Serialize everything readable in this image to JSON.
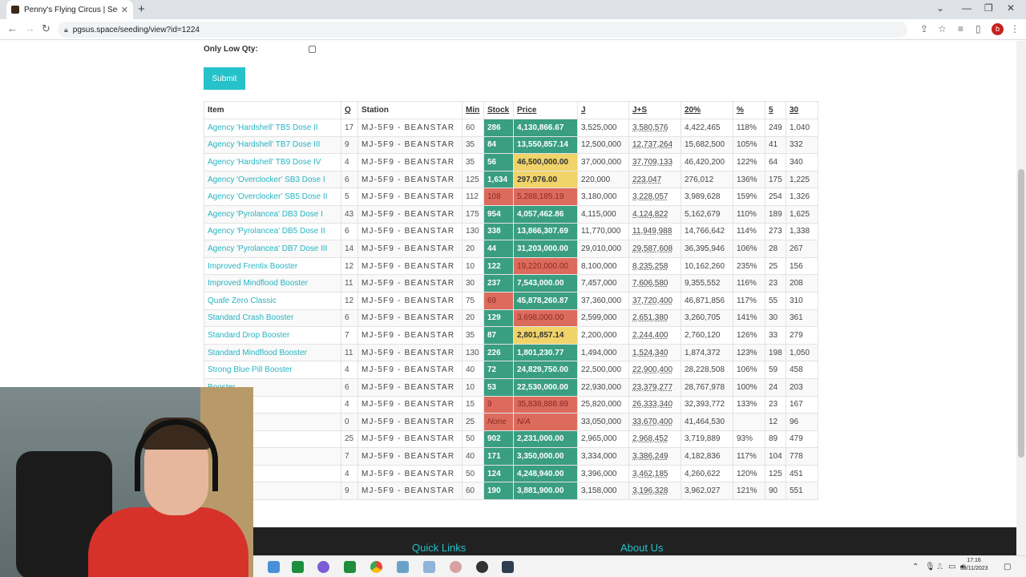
{
  "browser": {
    "tab_title": "Penny's Flying Circus | Seeding",
    "url": "pgsus.space/seeding/view?id=1224"
  },
  "form": {
    "low_qty_label": "Only Low Qty:",
    "submit_label": "Submit"
  },
  "table": {
    "headers": [
      "Item",
      "Q",
      "Station",
      "Min",
      "Stock",
      "Price",
      "J",
      "J+S",
      "20%",
      "%",
      "5",
      "30"
    ],
    "rows": [
      {
        "item": "Agency 'Hardshell' TB5 Dose II",
        "q": "17",
        "station": "MJ-5F9 - BEANSTAR",
        "min": "60",
        "stock": "286",
        "stock_color": "green",
        "price": "4,130,866.67",
        "price_color": "green",
        "j": "3,525,000",
        "js": "3,580,576",
        "p20": "4,422,465",
        "pct": "118%",
        "f5": "249",
        "t30": "1,040"
      },
      {
        "item": "Agency 'Hardshell' TB7 Dose III",
        "q": "9",
        "station": "MJ-5F9 - BEANSTAR",
        "min": "35",
        "stock": "84",
        "stock_color": "green",
        "price": "13,550,857.14",
        "price_color": "green",
        "j": "12,500,000",
        "js": "12,737,264",
        "p20": "15,682,500",
        "pct": "105%",
        "f5": "41",
        "t30": "332"
      },
      {
        "item": "Agency 'Hardshell' TB9 Dose IV",
        "q": "4",
        "station": "MJ-5F9 - BEANSTAR",
        "min": "35",
        "stock": "56",
        "stock_color": "green",
        "price": "46,500,000.00",
        "price_color": "yellow",
        "j": "37,000,000",
        "js": "37,709,133",
        "p20": "46,420,200",
        "pct": "122%",
        "f5": "64",
        "t30": "340"
      },
      {
        "item": "Agency 'Overclocker' SB3 Dose I",
        "q": "6",
        "station": "MJ-5F9 - BEANSTAR",
        "min": "125",
        "stock": "1,634",
        "stock_color": "green",
        "price": "297,976.00",
        "price_color": "yellow",
        "j": "220,000",
        "js": "223,047",
        "p20": "276,012",
        "pct": "136%",
        "f5": "175",
        "t30": "1,225"
      },
      {
        "item": "Agency 'Overclocker' SB5 Dose II",
        "q": "5",
        "station": "MJ-5F9 - BEANSTAR",
        "min": "112",
        "stock": "108",
        "stock_color": "red",
        "price": "5,288,185.19",
        "price_color": "red",
        "j": "3,180,000",
        "js": "3,228,057",
        "p20": "3,989,628",
        "pct": "159%",
        "f5": "254",
        "t30": "1,326"
      },
      {
        "item": "Agency 'Pyrolancea' DB3 Dose I",
        "q": "43",
        "station": "MJ-5F9 - BEANSTAR",
        "min": "175",
        "stock": "954",
        "stock_color": "green",
        "price": "4,057,462.86",
        "price_color": "green",
        "j": "4,115,000",
        "js": "4,124,822",
        "p20": "5,162,679",
        "pct": "110%",
        "f5": "189",
        "t30": "1,625"
      },
      {
        "item": "Agency 'Pyrolancea' DB5 Dose II",
        "q": "6",
        "station": "MJ-5F9 - BEANSTAR",
        "min": "130",
        "stock": "338",
        "stock_color": "green",
        "price": "13,866,307.69",
        "price_color": "green",
        "j": "11,770,000",
        "js": "11,949,988",
        "p20": "14,766,642",
        "pct": "114%",
        "f5": "273",
        "t30": "1,338"
      },
      {
        "item": "Agency 'Pyrolancea' DB7 Dose III",
        "q": "14",
        "station": "MJ-5F9 - BEANSTAR",
        "min": "20",
        "stock": "44",
        "stock_color": "green",
        "price": "31,203,000.00",
        "price_color": "green",
        "j": "29,010,000",
        "js": "29,587,608",
        "p20": "36,395,946",
        "pct": "106%",
        "f5": "28",
        "t30": "267"
      },
      {
        "item": "Improved Frentix Booster",
        "q": "12",
        "station": "MJ-5F9 - BEANSTAR",
        "min": "10",
        "stock": "122",
        "stock_color": "green",
        "price": "19,220,000.00",
        "price_color": "red",
        "j": "8,100,000",
        "js": "8,235,258",
        "p20": "10,162,260",
        "pct": "235%",
        "f5": "25",
        "t30": "156"
      },
      {
        "item": "Improved Mindflood Booster",
        "q": "11",
        "station": "MJ-5F9 - BEANSTAR",
        "min": "30",
        "stock": "237",
        "stock_color": "green",
        "price": "7,543,000.00",
        "price_color": "green",
        "j": "7,457,000",
        "js": "7,606,580",
        "p20": "9,355,552",
        "pct": "116%",
        "f5": "23",
        "t30": "208"
      },
      {
        "item": "Quafe Zero Classic",
        "q": "12",
        "station": "MJ-5F9 - BEANSTAR",
        "min": "75",
        "stock": "69",
        "stock_color": "red",
        "price": "45,878,260.87",
        "price_color": "green",
        "j": "37,360,000",
        "js": "37,720,400",
        "p20": "46,871,856",
        "pct": "117%",
        "f5": "55",
        "t30": "310"
      },
      {
        "item": "Standard Crash Booster",
        "q": "6",
        "station": "MJ-5F9 - BEANSTAR",
        "min": "20",
        "stock": "129",
        "stock_color": "green",
        "price": "3,698,000.00",
        "price_color": "red",
        "j": "2,599,000",
        "js": "2,651,380",
        "p20": "3,260,705",
        "pct": "141%",
        "f5": "30",
        "t30": "361"
      },
      {
        "item": "Standard Drop Booster",
        "q": "7",
        "station": "MJ-5F9 - BEANSTAR",
        "min": "35",
        "stock": "87",
        "stock_color": "green",
        "price": "2,801,857.14",
        "price_color": "yellow",
        "j": "2,200,000",
        "js": "2,244,400",
        "p20": "2,760,120",
        "pct": "126%",
        "f5": "33",
        "t30": "279"
      },
      {
        "item": "Standard Mindflood Booster",
        "q": "11",
        "station": "MJ-5F9 - BEANSTAR",
        "min": "130",
        "stock": "226",
        "stock_color": "green",
        "price": "1,801,230.77",
        "price_color": "green",
        "j": "1,494,000",
        "js": "1,524,340",
        "p20": "1,874,372",
        "pct": "123%",
        "f5": "198",
        "t30": "1,050"
      },
      {
        "item": "Strong Blue Pill Booster",
        "q": "4",
        "station": "MJ-5F9 - BEANSTAR",
        "min": "40",
        "stock": "72",
        "stock_color": "green",
        "price": "24,829,750.00",
        "price_color": "green",
        "j": "22,500,000",
        "js": "22,900,400",
        "p20": "28,228,508",
        "pct": "106%",
        "f5": "59",
        "t30": "458"
      },
      {
        "item": "Booster",
        "q": "6",
        "station": "MJ-5F9 - BEANSTAR",
        "min": "10",
        "stock": "53",
        "stock_color": "green",
        "price": "22,530,000.00",
        "price_color": "green",
        "j": "22,930,000",
        "js": "23,379,277",
        "p20": "28,767,978",
        "pct": "100%",
        "f5": "24",
        "t30": "203"
      },
      {
        "item": "ooster",
        "q": "4",
        "station": "MJ-5F9 - BEANSTAR",
        "min": "15",
        "stock": "9",
        "stock_color": "red",
        "price": "35,838,888.89",
        "price_color": "red",
        "j": "25,820,000",
        "js": "26,333,340",
        "p20": "32,393,772",
        "pct": "133%",
        "f5": "23",
        "t30": "167"
      },
      {
        "item": "lood Booster",
        "q": "0",
        "station": "MJ-5F9 - BEANSTAR",
        "min": "25",
        "stock": "None",
        "stock_color": "red",
        "price": "N/A",
        "price_color": "red",
        "j": "33,050,000",
        "js": "33,670,400",
        "p20": "41,464,530",
        "pct": "",
        "f5": "12",
        "t30": "96"
      },
      {
        "item": "ll Booster",
        "q": "25",
        "station": "MJ-5F9 - BEANSTAR",
        "min": "50",
        "stock": "902",
        "stock_color": "green",
        "price": "2,231,000.00",
        "price_color": "green",
        "j": "2,965,000",
        "js": "2,968,452",
        "p20": "3,719,889",
        "pct": "93%",
        "f5": "89",
        "t30": "479"
      },
      {
        "item": "Booster",
        "q": "7",
        "station": "MJ-5F9 - BEANSTAR",
        "min": "40",
        "stock": "171",
        "stock_color": "green",
        "price": "3,350,000.00",
        "price_color": "green",
        "j": "3,334,000",
        "js": "3,386,249",
        "p20": "4,182,836",
        "pct": "117%",
        "f5": "104",
        "t30": "778"
      },
      {
        "item": "ooster",
        "q": "4",
        "station": "MJ-5F9 - BEANSTAR",
        "min": "50",
        "stock": "124",
        "stock_color": "green",
        "price": "4,248,940.00",
        "price_color": "green",
        "j": "3,396,000",
        "js": "3,462,185",
        "p20": "4,260,622",
        "pct": "120%",
        "f5": "125",
        "t30": "451"
      },
      {
        "item": "Booster",
        "q": "9",
        "station": "MJ-5F9 - BEANSTAR",
        "min": "60",
        "stock": "190",
        "stock_color": "green",
        "price": "3,881,900.00",
        "price_color": "green",
        "j": "3,158,000",
        "js": "3,196,328",
        "p20": "3,962,027",
        "pct": "121%",
        "f5": "90",
        "t30": "551"
      }
    ]
  },
  "footer": {
    "quick_links": "Quick Links",
    "about_us": "About Us"
  },
  "taskbar": {
    "time": "17:16",
    "date": "03/11/2023"
  },
  "colors": {
    "accent": "#26c2c9",
    "green": "#3a9e80",
    "red": "#dc6b5d",
    "yellow": "#f0d46a"
  }
}
